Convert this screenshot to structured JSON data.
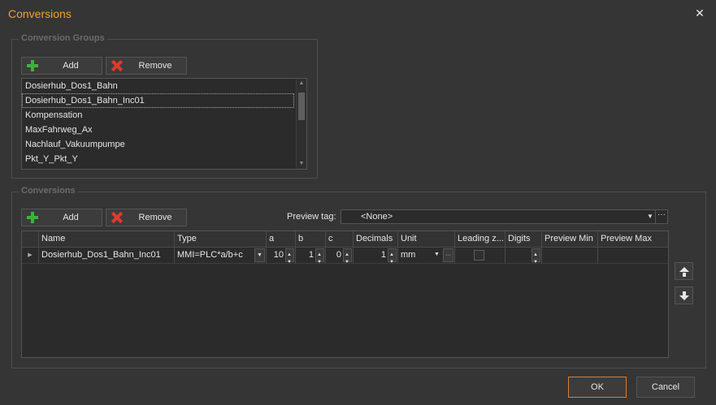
{
  "window": {
    "title": "Conversions"
  },
  "groups_section": {
    "title": "Conversion Groups",
    "add_label": "Add",
    "remove_label": "Remove",
    "items": [
      "Dosierhub_Dos1_Bahn",
      "Dosierhub_Dos1_Bahn_Inc01",
      "Kompensation",
      "MaxFahrweg_Ax",
      "Nachlauf_Vakuumpumpe",
      "Pkt_Y_Pkt_Y"
    ],
    "selected_index": 1
  },
  "conversions_section": {
    "title": "Conversions",
    "add_label": "Add",
    "remove_label": "Remove",
    "preview_tag_label": "Preview tag:",
    "preview_tag_value": "<None>",
    "columns": [
      "Name",
      "Type",
      "a",
      "b",
      "c",
      "Decimals",
      "Unit",
      "Leading z...",
      "Digits",
      "Preview Min",
      "Preview Max"
    ],
    "rows": [
      {
        "name": "Dosierhub_Dos1_Bahn_Inc01",
        "type": "MMI=PLC*a/b+c",
        "a": "10",
        "b": "1",
        "c": "0",
        "decimals": "1",
        "unit": "mm",
        "leading_zeros": false,
        "digits": "",
        "preview_min": "",
        "preview_max": ""
      }
    ]
  },
  "footer": {
    "ok_label": "OK",
    "cancel_label": "Cancel"
  },
  "colors": {
    "title": "#f0a030",
    "ok_border": "#e07b2a",
    "add_icon": "#3bb33b",
    "remove_icon": "#e03a2a"
  }
}
